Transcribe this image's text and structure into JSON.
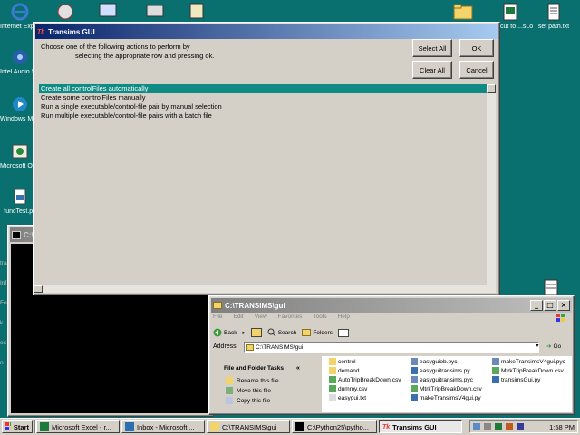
{
  "desktop": {
    "icons": [
      {
        "label": "Internet Explorer",
        "name": "internet-explorer"
      },
      {
        "label": "Intel Audio Studio",
        "name": "intel-audio-studio"
      },
      {
        "label": "Windows Media Player",
        "name": "windows-media-player"
      },
      {
        "label": "Microsoft Office Outlook",
        "name": "office-outlook"
      },
      {
        "label": "funcTest.py",
        "name": "functest-py"
      },
      {
        "label": "...ortcut to ...sLog.xls",
        "name": "shortcut-log-xls"
      },
      {
        "label": "set path.txt",
        "name": "set-path-txt"
      }
    ]
  },
  "transims_window": {
    "title": "Transims GUI",
    "instructions_line1": "Choose one of the following actions to perform by",
    "instructions_line2": "selecting the appropriate row and pressing ok.",
    "buttons": {
      "select_all": "Select All",
      "ok": "OK",
      "clear_all": "Clear All",
      "cancel": "Cancel"
    },
    "actions": [
      "Create all controlFiles automatically",
      "Create some controlFiles manually",
      "Run a single executable/control-file pair by manual selection",
      "Run multiple executable/control-file pairs with a batch file"
    ],
    "selected_index": 0
  },
  "console_window": {
    "title": "C:\\",
    "side_letters": [
      "tra",
      "Inf",
      "Fo",
      "k",
      "ex",
      "n"
    ]
  },
  "explorer_window": {
    "title": "C:\\TRANSIMS\\gui",
    "menu": [
      "File",
      "Edit",
      "View",
      "Favorites",
      "Tools",
      "Help"
    ],
    "toolbar": {
      "back": "Back",
      "search": "Search",
      "folders": "Folders"
    },
    "address_label": "Address",
    "address_value": "C:\\TRANSIMS\\gui",
    "go_label": "Go",
    "tasks_title": "File and Folder Tasks",
    "tasks": [
      "Rename this file",
      "Move this file",
      "Copy this file"
    ],
    "files_col1": [
      "control",
      "demand",
      "AutoTripBreakDown.csv",
      "dummy.csv",
      "easygui.txt"
    ],
    "files_col2": [
      "easyguiob.pyc",
      "easyguitransims.py",
      "easyguitransims.pyc",
      "MtrkTripBreakDown.csv",
      "makeTransimsV4gui.py"
    ],
    "files_col3": [
      "makeTransimsV4gui.pyc",
      "MtrkTripBreakDown.csv",
      "transimsGui.py"
    ]
  },
  "taskbar": {
    "start": "Start",
    "items": [
      {
        "label": "Microsoft Excel - r...",
        "name": "task-excel"
      },
      {
        "label": "Inbox - Microsoft ...",
        "name": "task-inbox"
      },
      {
        "label": "C:\\TRANSIMS\\gui",
        "name": "task-explorer"
      },
      {
        "label": "C:\\Python25\\pytho...",
        "name": "task-python"
      },
      {
        "label": "Transims GUI",
        "name": "task-transims"
      }
    ],
    "clock": "1:58 PM"
  },
  "colors": {
    "desktop": "#0a6f6f",
    "title_active": "#0a246a",
    "selection": "#0f8a85",
    "face": "#d4d0c8"
  }
}
